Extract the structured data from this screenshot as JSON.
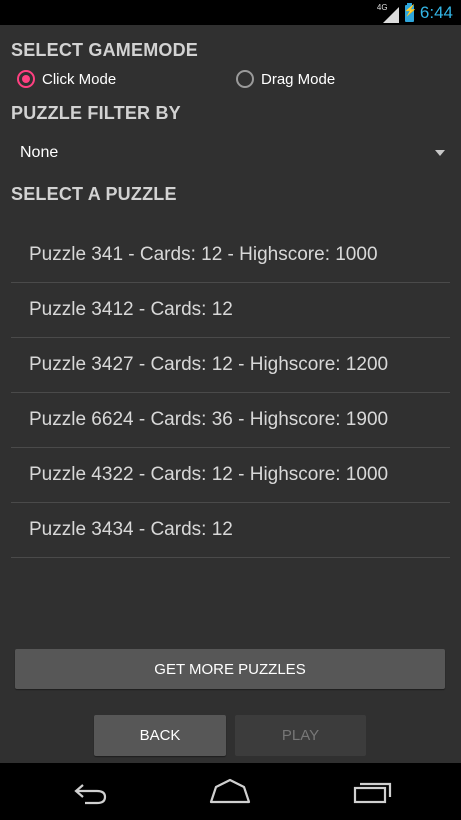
{
  "status_bar": {
    "network": "4G",
    "time": "6:44"
  },
  "gamemode": {
    "title": "SELECT GAMEMODE",
    "options": [
      {
        "label": "Click Mode",
        "selected": true
      },
      {
        "label": "Drag Mode",
        "selected": false
      }
    ]
  },
  "filter": {
    "title": "PUZZLE FILTER BY",
    "selected": "None"
  },
  "puzzles": {
    "title": "SELECT A PUZZLE",
    "items": [
      "Puzzle 341 - Cards: 12 - Highscore: 1000",
      "Puzzle 3412 - Cards: 12",
      "Puzzle 3427 - Cards: 12 - Highscore: 1200",
      "Puzzle 6624 - Cards: 36 - Highscore: 1900",
      "Puzzle 4322 - Cards: 12 - Highscore: 1000",
      "Puzzle 3434 - Cards: 12"
    ]
  },
  "buttons": {
    "get_more": "GET MORE PUZZLES",
    "back": "BACK",
    "play": "PLAY"
  },
  "colors": {
    "accent": "#ff4081",
    "clock": "#33b5e5",
    "background": "#303030"
  }
}
